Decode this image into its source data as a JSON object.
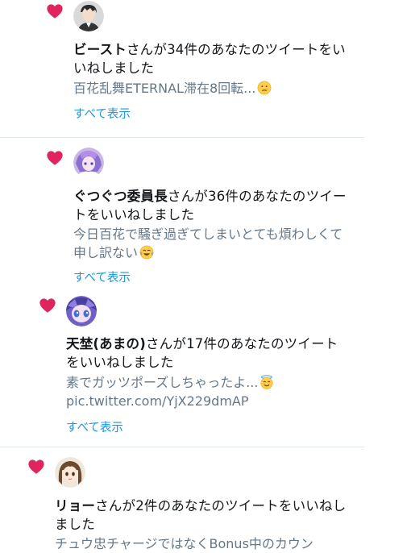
{
  "notifications": [
    {
      "user": "ビースト",
      "action": "さんが34件のあなたのツイートをいいねしました",
      "preview": "百花乱舞ETERNAL滞在8回転...",
      "show_all": "すべて表示"
    },
    {
      "user": "ぐつぐつ委員長",
      "action": "さんが36件のあなたのツイートをいいねしました",
      "preview": "今日百花で騒ぎ過ぎてしまいとても煩わしくて申し訳ない",
      "show_all": "すべて表示"
    },
    {
      "user": "天埜(あまの)",
      "action": "さんが17件のあなたのツイートをいいねしました",
      "preview": "素でガッツポーズしちゃったよ...",
      "preview_link": "pic.twitter.com/YjX229dmAP",
      "show_all": "すべて表示"
    },
    {
      "user": "リョー",
      "action": "さんが2件のあなたのツイートをいいねしました",
      "preview": "チュウ忠チャージではなくBonus中のカウン"
    }
  ],
  "icons": {
    "like": "heart-icon",
    "emoji_1": "crying-face-emoji",
    "emoji_2": "tears-of-joy-emoji",
    "emoji_3": "smiling-face-with-halo-emoji"
  },
  "colors": {
    "heart": "#e0245e",
    "link": "#1b95e0",
    "preview_text": "#657786",
    "divider": "#e1e8ed"
  }
}
